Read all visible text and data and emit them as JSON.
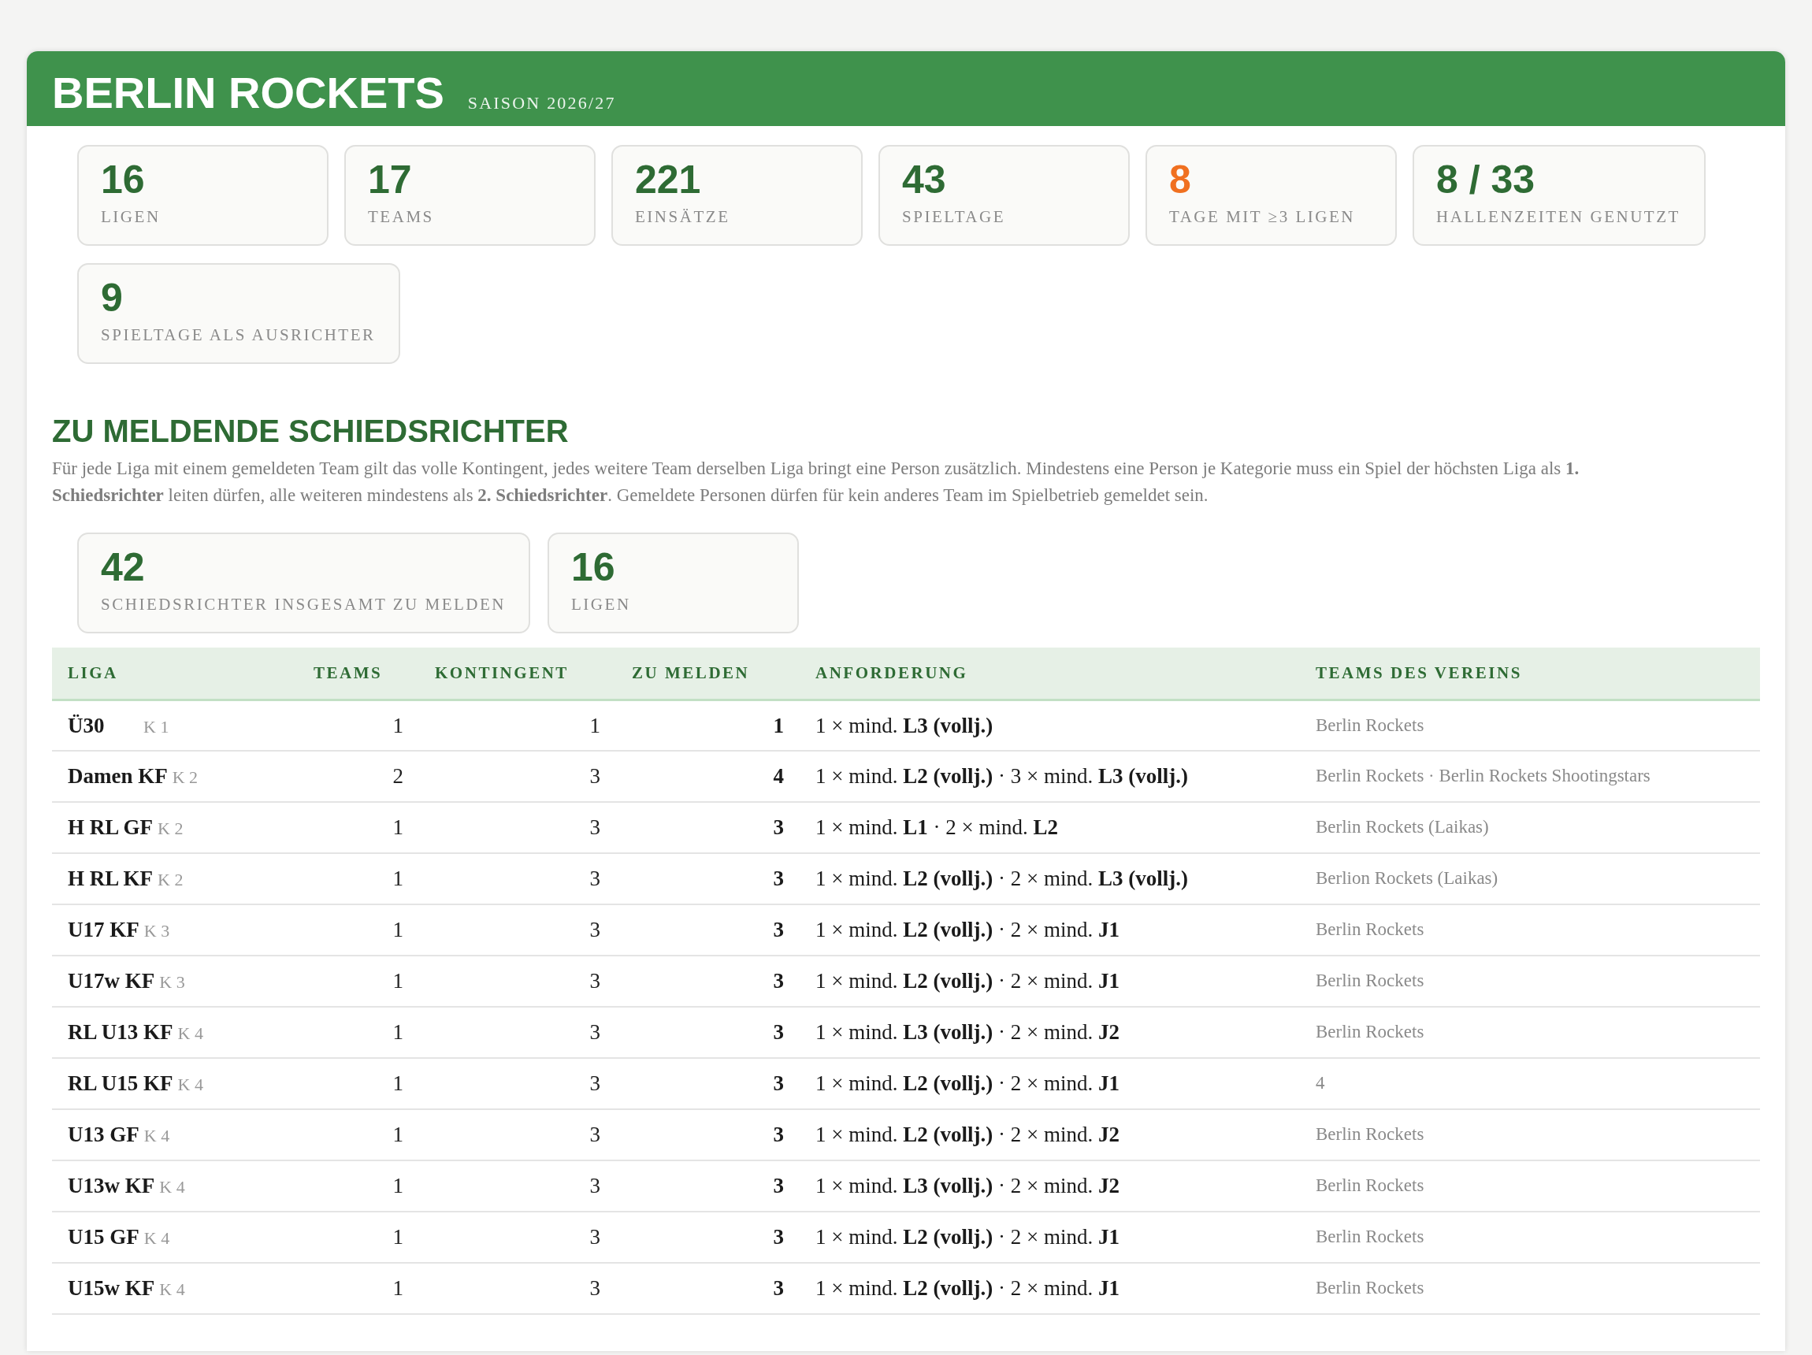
{
  "header": {
    "title": "BERLIN ROCKETS",
    "season": "SAISON 2026/27"
  },
  "stats": [
    {
      "value": "16",
      "label": "LIGEN",
      "highlight": false
    },
    {
      "value": "17",
      "label": "TEAMS",
      "highlight": false
    },
    {
      "value": "221",
      "label": "EINSÄTZE",
      "highlight": false
    },
    {
      "value": "43",
      "label": "SPIELTAGE",
      "highlight": false
    },
    {
      "value": "8",
      "label": "TAGE MIT ≥3 LIGEN",
      "highlight": true
    },
    {
      "value": "8 / 33",
      "label": "HALLENZEITEN GENUTZT",
      "highlight": false
    },
    {
      "value": "9",
      "label": "SPIELTAGE ALS AUSRICHTER",
      "highlight": false
    }
  ],
  "section": {
    "title": "ZU MELDENDE SCHIEDSRICHTER",
    "description": "Für jede Liga mit einem gemeldeten Team gilt das volle Kontingent, jedes weitere Team derselben Liga bringt eine Person zusätzlich. Mindestens eine Person je Kategorie muss ein Spiel der höchsten Liga als **1. Schiedsrichter** leiten dürfen, alle weiteren mindestens als **2. Schiedsrichter**. Gemeldete Personen dürfen für kein anderes Team im Spielbetrieb gemeldet sein.",
    "summary": [
      {
        "value": "42",
        "label": "SCHIEDSRICHTER INSGESAMT ZU MELDEN"
      },
      {
        "value": "16",
        "label": "LIGEN"
      }
    ]
  },
  "table": {
    "columns": [
      "LIGA",
      "TEAMS",
      "KONTINGENT",
      "ZU MELDEN",
      "ANFORDERUNG",
      "TEAMS DES VEREINS"
    ],
    "rows": [
      {
        "liga": "Ü30",
        "kategorie": "K 1",
        "teams": "1",
        "kontingent": "1",
        "zu_melden": "1",
        "anforderung": "1 × mind. **L3 (vollj.)**",
        "vereinsteams": "Berlin Rockets"
      },
      {
        "liga": "Damen KF",
        "kategorie": "K 2",
        "teams": "2",
        "kontingent": "3",
        "zu_melden": "4",
        "anforderung": "1 × mind. **L2 (vollj.)** · 3 × mind. **L3 (vollj.)**",
        "vereinsteams": "Berlin Rockets · Berlin Rockets Shootingstars"
      },
      {
        "liga": "H RL GF",
        "kategorie": "K 2",
        "teams": "1",
        "kontingent": "3",
        "zu_melden": "3",
        "anforderung": "1 × mind. **L1** · 2 × mind. **L2**",
        "vereinsteams": "Berlin Rockets (Laikas)"
      },
      {
        "liga": "H RL KF",
        "kategorie": "K 2",
        "teams": "1",
        "kontingent": "3",
        "zu_melden": "3",
        "anforderung": "1 × mind. **L2 (vollj.)** · 2 × mind. **L3 (vollj.)**",
        "vereinsteams": "Berlion Rockets (Laikas)"
      },
      {
        "liga": "U17 KF",
        "kategorie": "K 3",
        "teams": "1",
        "kontingent": "3",
        "zu_melden": "3",
        "anforderung": "1 × mind. **L2 (vollj.)** · 2 × mind. **J1**",
        "vereinsteams": "Berlin Rockets"
      },
      {
        "liga": "U17w KF",
        "kategorie": "K 3",
        "teams": "1",
        "kontingent": "3",
        "zu_melden": "3",
        "anforderung": "1 × mind. **L2 (vollj.)** · 2 × mind. **J1**",
        "vereinsteams": "Berlin Rockets"
      },
      {
        "liga": "RL U13 KF",
        "kategorie": "K 4",
        "teams": "1",
        "kontingent": "3",
        "zu_melden": "3",
        "anforderung": "1 × mind. **L3 (vollj.)** · 2 × mind. **J2**",
        "vereinsteams": "Berlin Rockets"
      },
      {
        "liga": "RL U15 KF",
        "kategorie": "K 4",
        "teams": "1",
        "kontingent": "3",
        "zu_melden": "3",
        "anforderung": "1 × mind. **L2 (vollj.)** · 2 × mind. **J1**",
        "vereinsteams": "4"
      },
      {
        "liga": "U13 GF",
        "kategorie": "K 4",
        "teams": "1",
        "kontingent": "3",
        "zu_melden": "3",
        "anforderung": "1 × mind. **L2 (vollj.)** · 2 × mind. **J2**",
        "vereinsteams": "Berlin Rockets"
      },
      {
        "liga": "U13w KF",
        "kategorie": "K 4",
        "teams": "1",
        "kontingent": "3",
        "zu_melden": "3",
        "anforderung": "1 × mind. **L3 (vollj.)** · 2 × mind. **J2**",
        "vereinsteams": "Berlin Rockets"
      },
      {
        "liga": "U15 GF",
        "kategorie": "K 4",
        "teams": "1",
        "kontingent": "3",
        "zu_melden": "3",
        "anforderung": "1 × mind. **L2 (vollj.)** · 2 × mind. **J1**",
        "vereinsteams": "Berlin Rockets"
      },
      {
        "liga": "U15w KF",
        "kategorie": "K 4",
        "teams": "1",
        "kontingent": "3",
        "zu_melden": "3",
        "anforderung": "1 × mind. **L2 (vollj.)** · 2 × mind. **J1**",
        "vereinsteams": "Berlin Rockets"
      }
    ]
  }
}
